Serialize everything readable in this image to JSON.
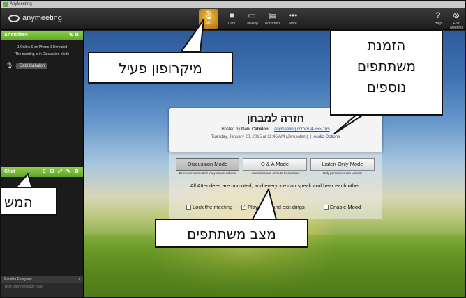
{
  "window": {
    "title": "AnyMeeting"
  },
  "toolbar": {
    "logo": "anymeeting",
    "mic_label": "Mic",
    "cam_label": "Cam",
    "desktop_label": "Desktop",
    "document_label": "Document",
    "more_label": "More",
    "help_label": "Help",
    "end_label": "End Meeting"
  },
  "sidebar": {
    "attendees_title": "Attendees",
    "stats_line1": "1 Online   0 on Phone   1 Unmuted",
    "stats_line2": "The meeting is in Discussion Mode",
    "attendee_name": "Gabi Cahalon",
    "chat_title": "Chat",
    "send_to": "Send to Everyone",
    "message_placeholder": "Type your message here"
  },
  "meeting": {
    "title": "חזרה למבחן",
    "hosted_by_prefix": "Hosted by ",
    "host": "Gabi Cahalon",
    "separator": "|",
    "dial_link": "anymeeting.com/304-655-165",
    "date": "Tuesday, January 20, 2015 at 11:46 AM (Jerusalem)",
    "audio_options": "Audio Options"
  },
  "modes": {
    "discussion": "Discussion Mode",
    "qa": "Q & A Mode",
    "listen": "Listen-Only Mode",
    "discussion_sub": "Everyone's unmuted (may cause echoes)",
    "qa_sub": "Attendees can unmute themselves",
    "listen_sub": "Only presenters can unmute",
    "description": "All Attendees are unmuted, and everyone can speak and hear each other."
  },
  "options": {
    "lock": "Lock the meeting",
    "dings": "Play entry and exit dings",
    "mood": "Enable Mood"
  },
  "annotations": {
    "mic_active": "מיקרופון פעיל",
    "invite_line1": "הזמנת",
    "invite_line2": "משתתפים",
    "invite_line3": "נוספים",
    "participants_mode": "מצב משתתפים",
    "left_partial": "המש"
  },
  "colors": {
    "accent_green": "#7cc13e",
    "mic_active": "#f0a020",
    "link": "#1a4f9e"
  }
}
